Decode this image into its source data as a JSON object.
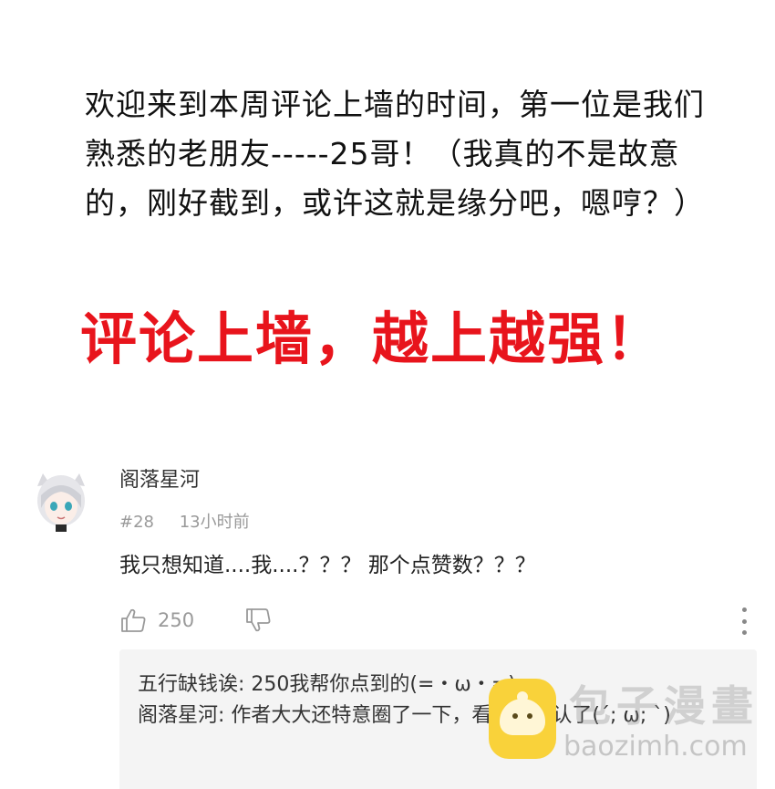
{
  "intro": {
    "text": "欢迎来到本周评论上墙的时间，第一位是我们熟悉的老朋友-----25哥！（我真的不是故意的，刚好截到，或许这就是缘分吧，嗯哼？）"
  },
  "slogan": {
    "text": "评论上墙，越上越强！",
    "color": "#e8141c"
  },
  "comment": {
    "avatar_icon": "anime-avatar-icon",
    "username": "阁落星河",
    "floor": "#28",
    "time": "13小时前",
    "text": "我只想知道....我....？？？ 那个点赞数？？？",
    "like_icon": "thumbs-up-icon",
    "likes": "250",
    "dislike_icon": "thumbs-down-icon",
    "more_icon": "more-vertical-icon"
  },
  "replies": [
    {
      "text": "五行缺钱诶: 250我帮你点到的(=・ω・=)"
    },
    {
      "text": "阁落星河: 作者大大还特意圈了一下，看来是承认了(´; ω; `)"
    }
  ],
  "watermark": {
    "title": "包子漫畫",
    "url": "baozimh.com",
    "logo_color": "#f9d23a"
  }
}
